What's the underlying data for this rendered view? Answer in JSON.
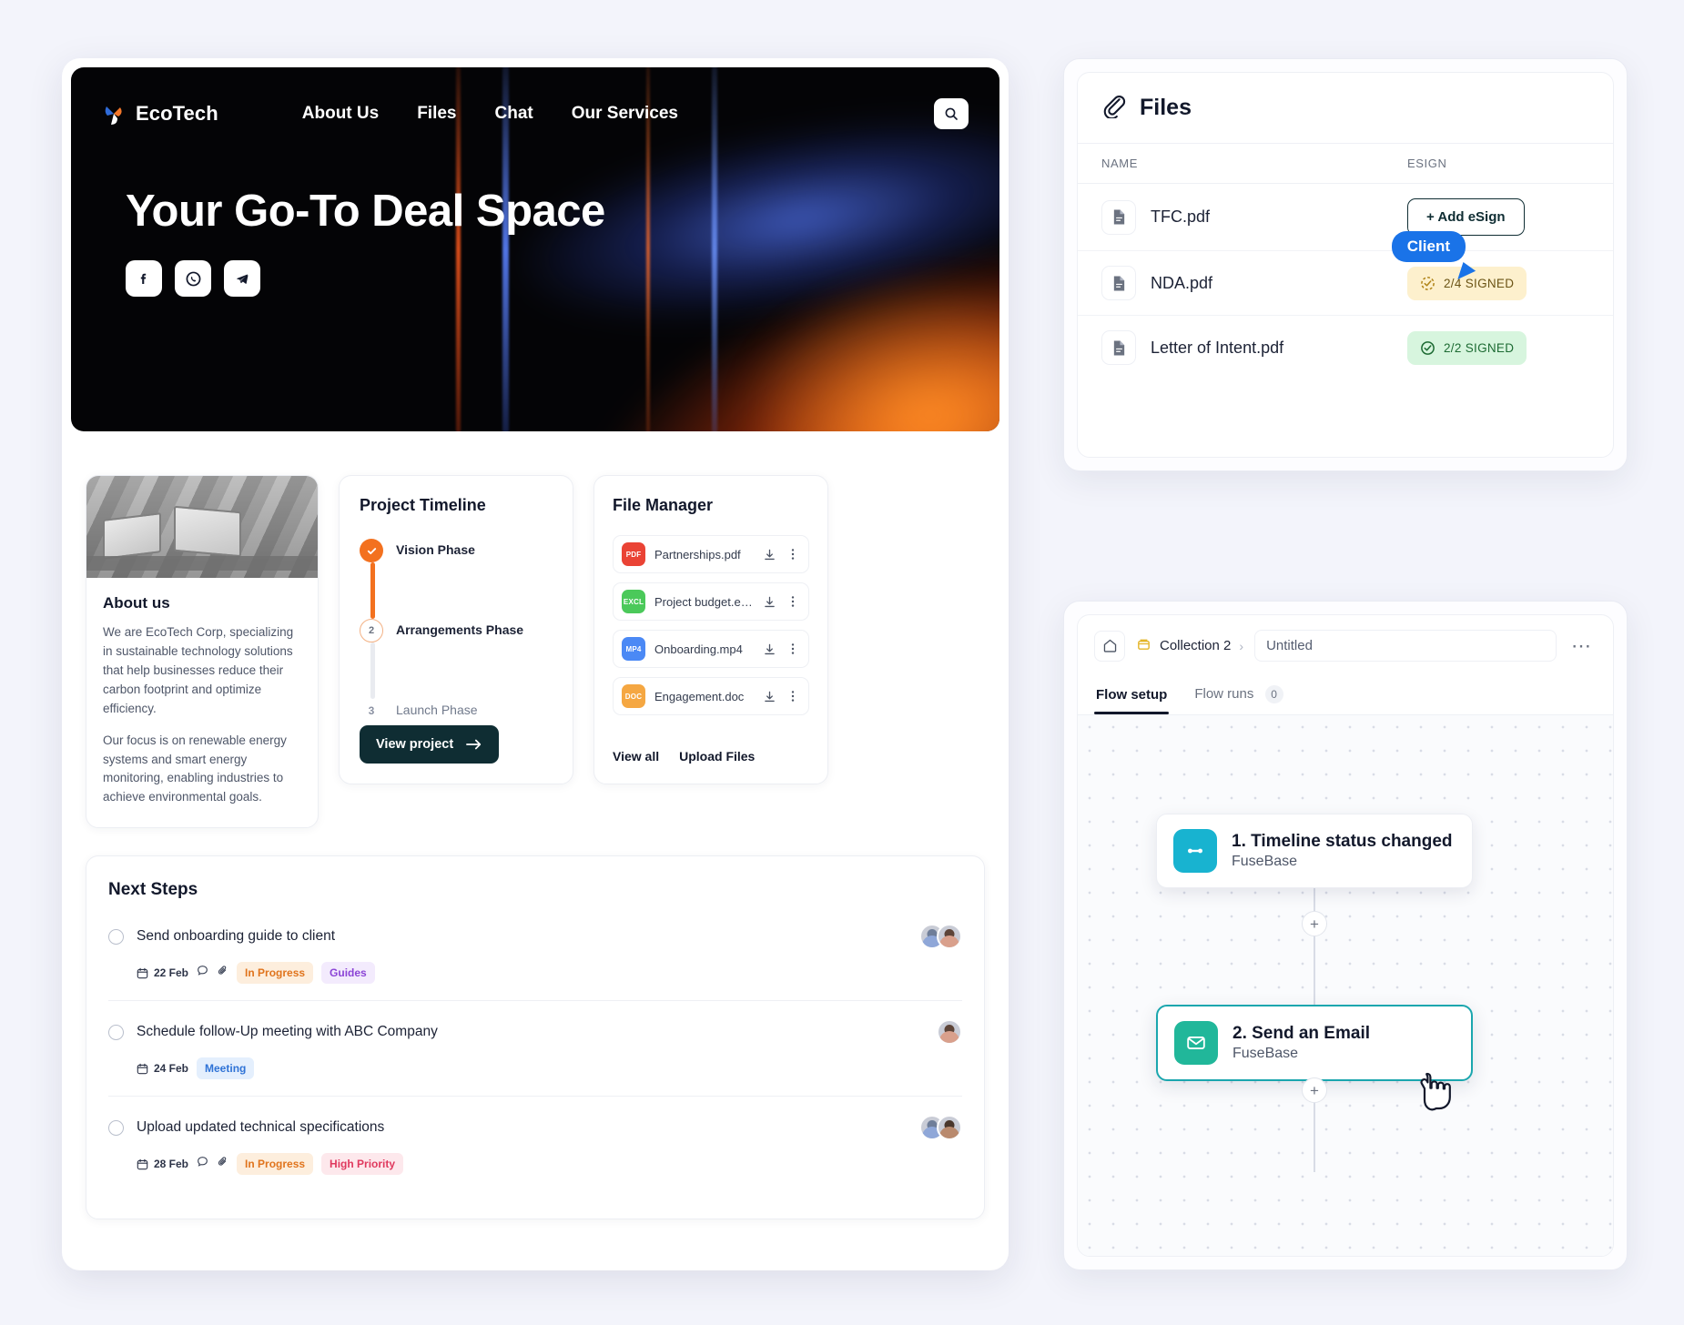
{
  "portal": {
    "nav": {
      "brand": "EcoTech",
      "links": [
        "About Us",
        "Files",
        "Chat",
        "Our Services"
      ],
      "search_icon": "search-icon"
    },
    "hero": {
      "title": "Your Go-To Deal Space",
      "socials": [
        "facebook-icon",
        "whatsapp-icon",
        "telegram-icon"
      ]
    },
    "about": {
      "title": "About us",
      "paragraph1": "We are EcoTech Corp, specializing in sustainable technology solutions that help businesses reduce their carbon footprint and optimize efficiency.",
      "paragraph2": "Our focus is on renewable energy systems and smart energy monitoring, enabling industries to achieve environmental goals."
    },
    "timeline": {
      "title": "Project Timeline",
      "items": [
        {
          "label": "Vision Phase",
          "marker": "check",
          "state": "done"
        },
        {
          "label": "Arrangements Phase",
          "marker": "2",
          "state": "current"
        },
        {
          "label": "Launch Phase",
          "marker": "3",
          "state": "todo"
        }
      ],
      "button": "View project"
    },
    "file_manager": {
      "title": "File Manager",
      "files": [
        {
          "name": "Partnerships.pdf",
          "type": "PDF",
          "color": "#ea4335"
        },
        {
          "name": "Project budget.excl",
          "type": "EXCL",
          "color": "#4bc95a"
        },
        {
          "name": "Onboarding.mp4",
          "type": "MP4",
          "color": "#4b89f5"
        },
        {
          "name": "Engagement.doc",
          "type": "DOC",
          "color": "#f5a742"
        }
      ],
      "footer": [
        "View all",
        "Upload Files"
      ]
    },
    "next_steps": {
      "title": "Next Steps",
      "tasks": [
        {
          "name": "Send onboarding guide to client",
          "date": "22 Feb",
          "has_comment": true,
          "has_attachment": true,
          "chips": [
            {
              "label": "In Progress",
              "style": "inprogress"
            },
            {
              "label": "Guides",
              "style": "guides"
            }
          ],
          "avatars": [
            "#8fa7d8",
            "#d9a08c"
          ]
        },
        {
          "name": "Schedule follow-Up meeting with ABC Company",
          "date": "24 Feb",
          "has_comment": false,
          "has_attachment": false,
          "chips": [
            {
              "label": "Meeting",
              "style": "meeting"
            }
          ],
          "avatars": [
            "#d9a08c"
          ]
        },
        {
          "name": "Upload updated technical specifications",
          "date": "28 Feb",
          "has_comment": true,
          "has_attachment": true,
          "chips": [
            {
              "label": "In Progress",
              "style": "inprogress"
            },
            {
              "label": "High Priority",
              "style": "high"
            }
          ],
          "avatars": [
            "#8fa7d8",
            "#b98a6e"
          ]
        }
      ]
    }
  },
  "files_panel": {
    "title": "Files",
    "title_icon": "paperclip-icon",
    "columns": {
      "name": "NAME",
      "esign": "ESIGN"
    },
    "rows": [
      {
        "name": "TFC.pdf",
        "esign_type": "button",
        "esign_label": "+ Add eSign"
      },
      {
        "name": "NDA.pdf",
        "esign_type": "badge_partial",
        "esign_label": "2/4 SIGNED"
      },
      {
        "name": "Letter of Intent.pdf",
        "esign_type": "badge_full",
        "esign_label": "2/2 SIGNED"
      }
    ],
    "cursor_label": "Client",
    "cursor_color": "#1a73e8"
  },
  "flow_panel": {
    "home_icon": "home-icon",
    "collection_icon": "folder-icon",
    "breadcrumb": "Collection 2",
    "document_title": "Untitled",
    "more_icon": "ellipsis-icon",
    "tabs": [
      {
        "label": "Flow setup",
        "active": true
      },
      {
        "label": "Flow runs",
        "active": false,
        "count": "0"
      }
    ],
    "nodes": [
      {
        "title": "1. Timeline status changed",
        "subtitle": "FuseBase",
        "icon": "trigger-icon",
        "color": "#18b3d0",
        "selected": false
      },
      {
        "title": "2. Send an Email",
        "subtitle": "FuseBase",
        "icon": "envelope-icon",
        "color": "#21b79a",
        "selected": true
      }
    ],
    "add_step_icon": "plus-icon"
  }
}
